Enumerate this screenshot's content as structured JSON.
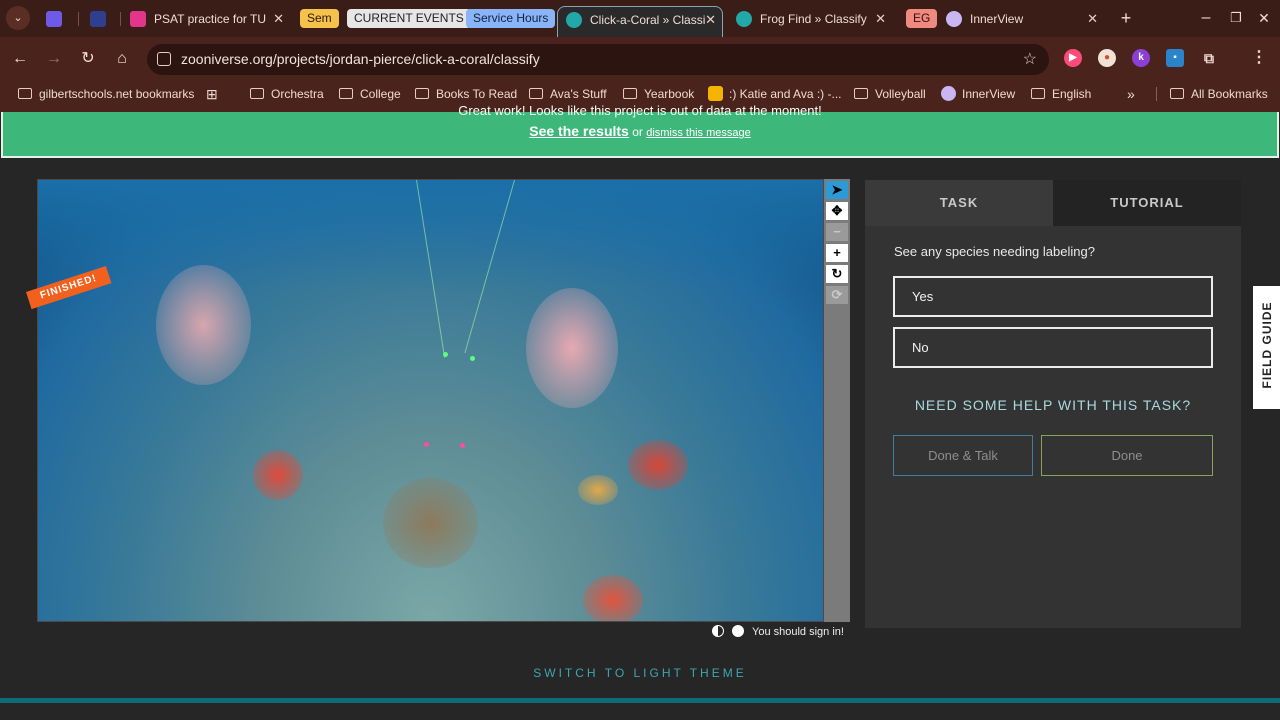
{
  "browser": {
    "tabs": [
      {
        "title": "PSAT practice for TU",
        "favicon_color": "#e3358b"
      },
      {
        "title": "Click-a-Coral » Classi",
        "favicon_color": "#22a8a8",
        "active": true
      },
      {
        "title": "Frog Find » Classify",
        "favicon_color": "#22a8a8"
      },
      {
        "title": "InnerView",
        "favicon_color": "#c9b6f2"
      }
    ],
    "tab_groups": [
      {
        "label": "Sem",
        "bg": "#f5c24b",
        "fg": "#2a1a0a"
      },
      {
        "label": "CURRENT EVENTS",
        "bg": "#e6e6e6",
        "fg": "#222222"
      },
      {
        "label": "Service Hours",
        "bg": "#8ab4f8",
        "fg": "#10213d"
      },
      {
        "label": "EG",
        "bg": "#ee8a80",
        "fg": "#3b0d0a"
      }
    ],
    "url": "zooniverse.org/projects/jordan-pierce/click-a-coral/classify",
    "bookmarks": [
      {
        "label": "gilbertschools.net bookmarks",
        "kind": "folder"
      },
      {
        "label": "Orchestra",
        "kind": "folder"
      },
      {
        "label": "College",
        "kind": "folder"
      },
      {
        "label": "Books To Read",
        "kind": "folder"
      },
      {
        "label": "Ava's Stuff",
        "kind": "folder"
      },
      {
        "label": "Yearbook",
        "kind": "folder"
      },
      {
        "label": ":) Katie and Ava :) -...",
        "kind": "site"
      },
      {
        "label": "Volleyball",
        "kind": "folder"
      },
      {
        "label": "InnerView",
        "kind": "site"
      },
      {
        "label": "English",
        "kind": "folder"
      },
      {
        "label": "All Bookmarks",
        "kind": "folder"
      }
    ]
  },
  "banner": {
    "line1": "Great work! Looks like this project is out of data at the moment!",
    "results_link": "See the results",
    "or_text": "or",
    "dismiss_link": "dismiss this message",
    "bg": "#3eb87a"
  },
  "subject": {
    "finished_label": "FINISHED!",
    "sign_in_text": "You should sign in!"
  },
  "task": {
    "tab_task": "TASK",
    "tab_tutorial": "TUTORIAL",
    "question": "See any species needing labeling?",
    "answers": [
      "Yes",
      "No"
    ],
    "help": "NEED SOME HELP WITH THIS TASK?",
    "done_talk": "Done & Talk",
    "done": "Done"
  },
  "field_guide": "FIELD GUIDE",
  "switch_theme": "SWITCH TO LIGHT THEME"
}
